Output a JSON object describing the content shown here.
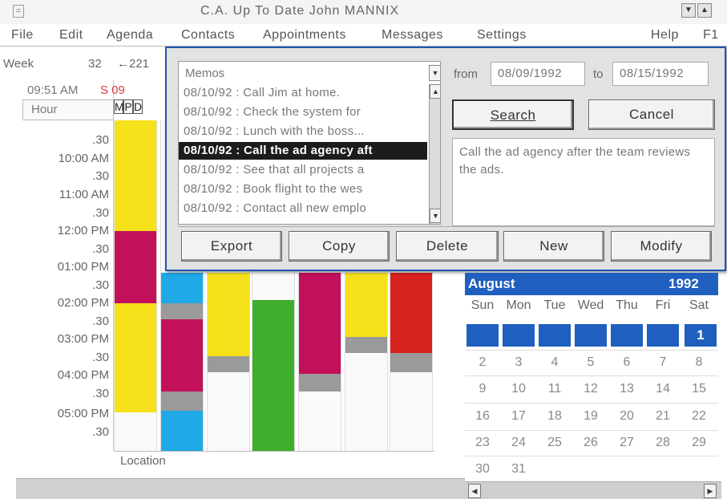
{
  "window": {
    "title": "C.A. Up To Date  John MANNIX",
    "system_menu": "=",
    "minimize_glyph": "▼",
    "maximize_glyph": "▲"
  },
  "menu": [
    "File",
    "Edit",
    "Agenda",
    "Contacts",
    "Appointments",
    "Messages",
    "Settings",
    "Help",
    "F1"
  ],
  "week_bar": {
    "week_label": "Week",
    "week_number": "32",
    "arrow_value": "←221"
  },
  "left": {
    "clock": "09:51 AM",
    "day_marker": "S 09",
    "hour_header": "Hour",
    "mpd": [
      "M",
      "P",
      "D"
    ],
    "times": [
      ".30",
      "10:00 AM",
      ".30",
      "11:00 AM",
      ".30",
      "12:00 PM",
      ".30",
      "01:00 PM",
      ".30",
      "02:00 PM",
      ".30",
      "03:00 PM",
      ".30",
      "04:00 PM",
      ".30",
      "05:00 PM",
      ".30"
    ],
    "location_label": "Location"
  },
  "dialog": {
    "list_title": "Memos",
    "memos": [
      "08/10/92 : Call Jim at home.",
      "08/10/92 : Check the system for",
      "08/10/92 : Lunch with the boss...",
      "08/10/92 : Call the ad agency aft",
      "08/10/92 : See that all projects a",
      "08/10/92 : Book flight to the wes",
      "08/10/92 : Contact all new emplo"
    ],
    "selected_index": 3,
    "from_label": "from",
    "from_date": "08/09/1992",
    "to_label": "to",
    "to_date": "08/15/1992",
    "search_label": "Search",
    "cancel_label": "Cancel",
    "details": "Call the ad agency after the team reviews the ads.",
    "buttons": [
      "Export",
      "Copy",
      "Delete",
      "New",
      "Modify"
    ]
  },
  "calendar": {
    "month": "August",
    "year": "1992",
    "weekdays": [
      "Sun",
      "Mon",
      "Tue",
      "Wed",
      "Thu",
      "Fri",
      "Sat"
    ],
    "first_day": "1",
    "weeks": [
      [
        "2",
        "3",
        "4",
        "5",
        "6",
        "7",
        "8"
      ],
      [
        "9",
        "10",
        "11",
        "12",
        "13",
        "14",
        "15"
      ],
      [
        "16",
        "17",
        "18",
        "19",
        "20",
        "21",
        "22"
      ],
      [
        "23",
        "24",
        "25",
        "26",
        "27",
        "28",
        "29"
      ],
      [
        "30",
        "31",
        "",
        "",
        "",
        "",
        ""
      ]
    ]
  },
  "colors": {
    "accent_blue": "#1f5fbf",
    "yellow": "#f6e21a",
    "magenta": "#c2105a",
    "cyan": "#1fa9e6",
    "green": "#3fae2c",
    "red": "#d8221e"
  }
}
